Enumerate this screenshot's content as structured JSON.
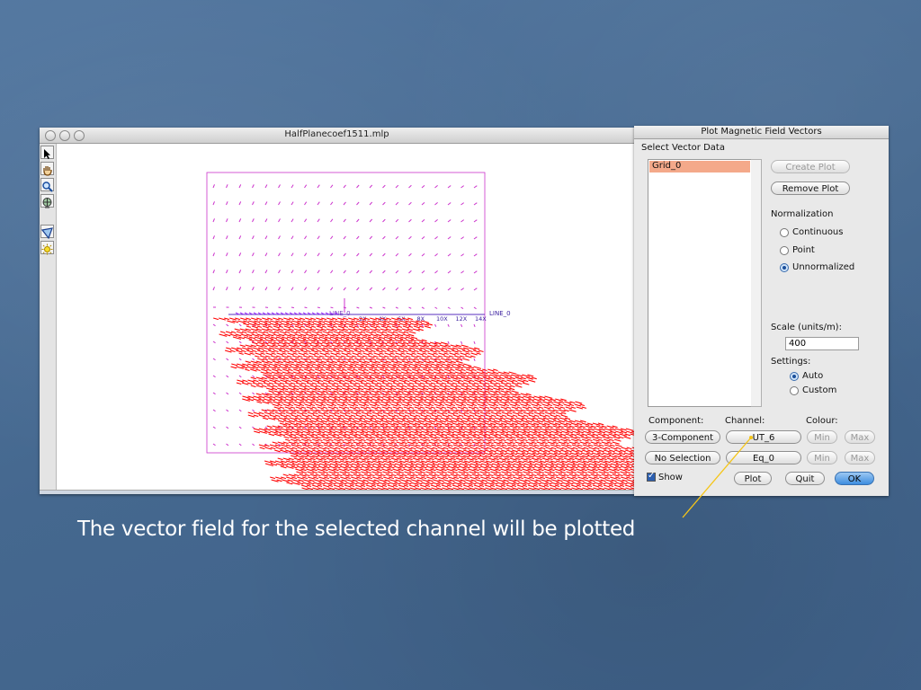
{
  "plot_window": {
    "title": "HalfPlanecoef1511.mlp",
    "tools": [
      "arrow-pointer-icon",
      "hand-icon",
      "magnifier-icon",
      "globe-icon",
      "camera-angle-icon",
      "sun-icon"
    ],
    "line_label": "LINE_0",
    "line_label_left": "LINE_0",
    "ticks": [
      "2X",
      "4X",
      "6X",
      "8X",
      "10X",
      "12X",
      "14X"
    ]
  },
  "dialog": {
    "title": "Plot Magnetic Field Vectors",
    "select_label": "Select Vector Data",
    "list_items": [
      "Grid_0"
    ],
    "create_plot": "Create Plot",
    "remove_plot": "Remove Plot",
    "normalization_label": "Normalization",
    "norm_options": [
      "Continuous",
      "Point",
      "Unnormalized"
    ],
    "norm_selected": "Unnormalized",
    "scale_label": "Scale (units/m):",
    "scale_value": "400",
    "settings_label": "Settings:",
    "settings_options": [
      "Auto",
      "Custom"
    ],
    "settings_selected": "Auto",
    "component_label": "Component:",
    "channel_label": "Channel:",
    "colour_label": "Colour:",
    "row1": {
      "component": "3-Component",
      "channel": "UT_6",
      "min": "Min",
      "max": "Max"
    },
    "row2": {
      "component": "No Selection",
      "channel": "Eq_0",
      "min": "Min",
      "max": "Max"
    },
    "show_label": "Show",
    "plot_button": "Plot",
    "quit_button": "Quit",
    "ok_button": "OK"
  },
  "caption": "The vector field for the selected channel will be plotted",
  "colors": {
    "background": "#4a6d95",
    "vectors_grid": "#cc33cc",
    "vectors_field": "#ff0000",
    "callout": "#f5c518"
  }
}
